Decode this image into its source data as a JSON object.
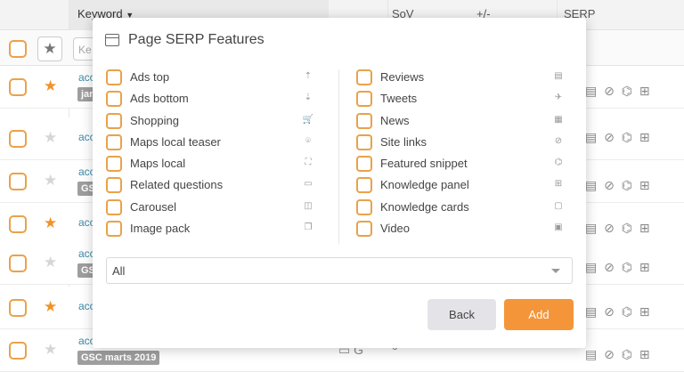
{
  "table": {
    "headers": {
      "keyword": "Keyword",
      "sov": "SoV",
      "plus_minus": "+/-",
      "serp": "SERP"
    },
    "keyword_placeholder": "Ke",
    "rows": [
      {
        "keyword": "acc",
        "tag": "jan",
        "starred": true
      },
      {
        "keyword": "acc",
        "tag": "",
        "starred": false
      },
      {
        "keyword": "acc",
        "tag": "GSC",
        "starred": false
      },
      {
        "keyword": "acc",
        "tag": "",
        "starred": true
      },
      {
        "keyword": "acc",
        "tag": "GS",
        "starred": false
      },
      {
        "keyword": "acc",
        "tag": "",
        "starred": true
      },
      {
        "keyword": "acc",
        "tag": "GSC marts 2019",
        "starred": false,
        "sov": "0"
      }
    ]
  },
  "modal": {
    "title": "Page SERP Features",
    "features_left": [
      {
        "label": "Ads top",
        "icon": "ads-top-icon"
      },
      {
        "label": "Ads bottom",
        "icon": "ads-bottom-icon"
      },
      {
        "label": "Shopping",
        "icon": "cart-icon"
      },
      {
        "label": "Maps local teaser",
        "icon": "map-pin-icon"
      },
      {
        "label": "Maps local",
        "icon": "map-icon"
      },
      {
        "label": "Related questions",
        "icon": "question-icon"
      },
      {
        "label": "Carousel",
        "icon": "carousel-icon"
      },
      {
        "label": "Image pack",
        "icon": "image-pack-icon"
      }
    ],
    "features_right": [
      {
        "label": "Reviews",
        "icon": "reviews-icon"
      },
      {
        "label": "Tweets",
        "icon": "tweet-icon"
      },
      {
        "label": "News",
        "icon": "news-icon"
      },
      {
        "label": "Site links",
        "icon": "link-icon"
      },
      {
        "label": "Featured snippet",
        "icon": "snippet-icon"
      },
      {
        "label": "Knowledge panel",
        "icon": "grid-icon"
      },
      {
        "label": "Knowledge cards",
        "icon": "cards-icon"
      },
      {
        "label": "Video",
        "icon": "video-icon"
      }
    ],
    "select_value": "All",
    "back_label": "Back",
    "add_label": "Add"
  },
  "colors": {
    "accent": "#f5953a",
    "checkbox_border": "#e9a24a",
    "link": "#3b8aa8"
  }
}
